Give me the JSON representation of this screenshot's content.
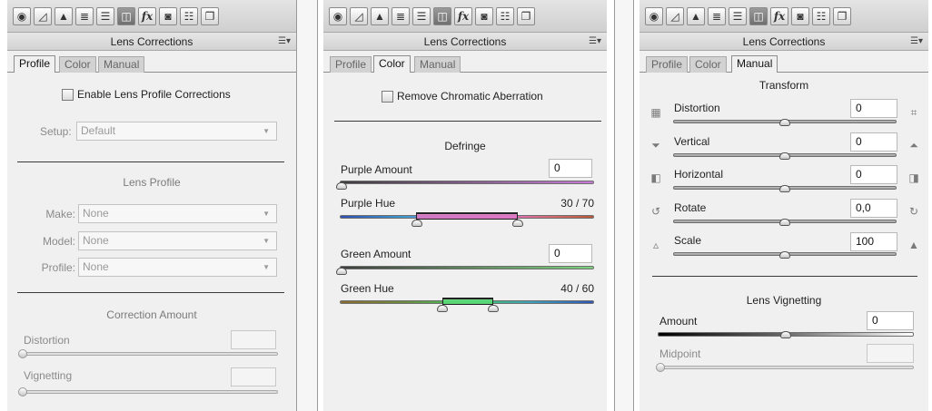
{
  "toolbar_icons": [
    "aperture-icon",
    "tone-curve-icon",
    "detail-icon",
    "hsl-icon",
    "split-toning-icon",
    "lens-corrections-icon",
    "fx-icon",
    "camera-calibration-icon",
    "presets-icon",
    "snapshots-icon"
  ],
  "panels": [
    {
      "title": "Lens Corrections",
      "tabs": [
        "Profile",
        "Color",
        "Manual"
      ],
      "active_tab": "Profile",
      "enable_checkbox": "Enable Lens Profile Corrections",
      "setup_label": "Setup:",
      "setup_value": "Default",
      "lens_profile_title": "Lens Profile",
      "make_label": "Make:",
      "make_value": "None",
      "model_label": "Model:",
      "model_value": "None",
      "profile_label": "Profile:",
      "profile_value": "None",
      "correction_amount_title": "Correction Amount",
      "distortion_label": "Distortion",
      "vignetting_label": "Vignetting"
    },
    {
      "title": "Lens Corrections",
      "tabs": [
        "Profile",
        "Color",
        "Manual"
      ],
      "active_tab": "Color",
      "remove_ca_checkbox": "Remove Chromatic Aberration",
      "defringe_title": "Defringe",
      "purple_amount_label": "Purple Amount",
      "purple_amount_value": "0",
      "purple_hue_label": "Purple Hue",
      "purple_hue_value": "30 / 70",
      "green_amount_label": "Green Amount",
      "green_amount_value": "0",
      "green_hue_label": "Green Hue",
      "green_hue_value": "40 / 60"
    },
    {
      "title": "Lens Corrections",
      "tabs": [
        "Profile",
        "Color",
        "Manual"
      ],
      "active_tab": "Manual",
      "transform_title": "Transform",
      "distortion_label": "Distortion",
      "distortion_value": "0",
      "vertical_label": "Vertical",
      "vertical_value": "0",
      "horizontal_label": "Horizontal",
      "horizontal_value": "0",
      "rotate_label": "Rotate",
      "rotate_value": "0,0",
      "scale_label": "Scale",
      "scale_value": "100",
      "vignetting_title": "Lens Vignetting",
      "amount_label": "Amount",
      "amount_value": "0",
      "midpoint_label": "Midpoint"
    }
  ]
}
